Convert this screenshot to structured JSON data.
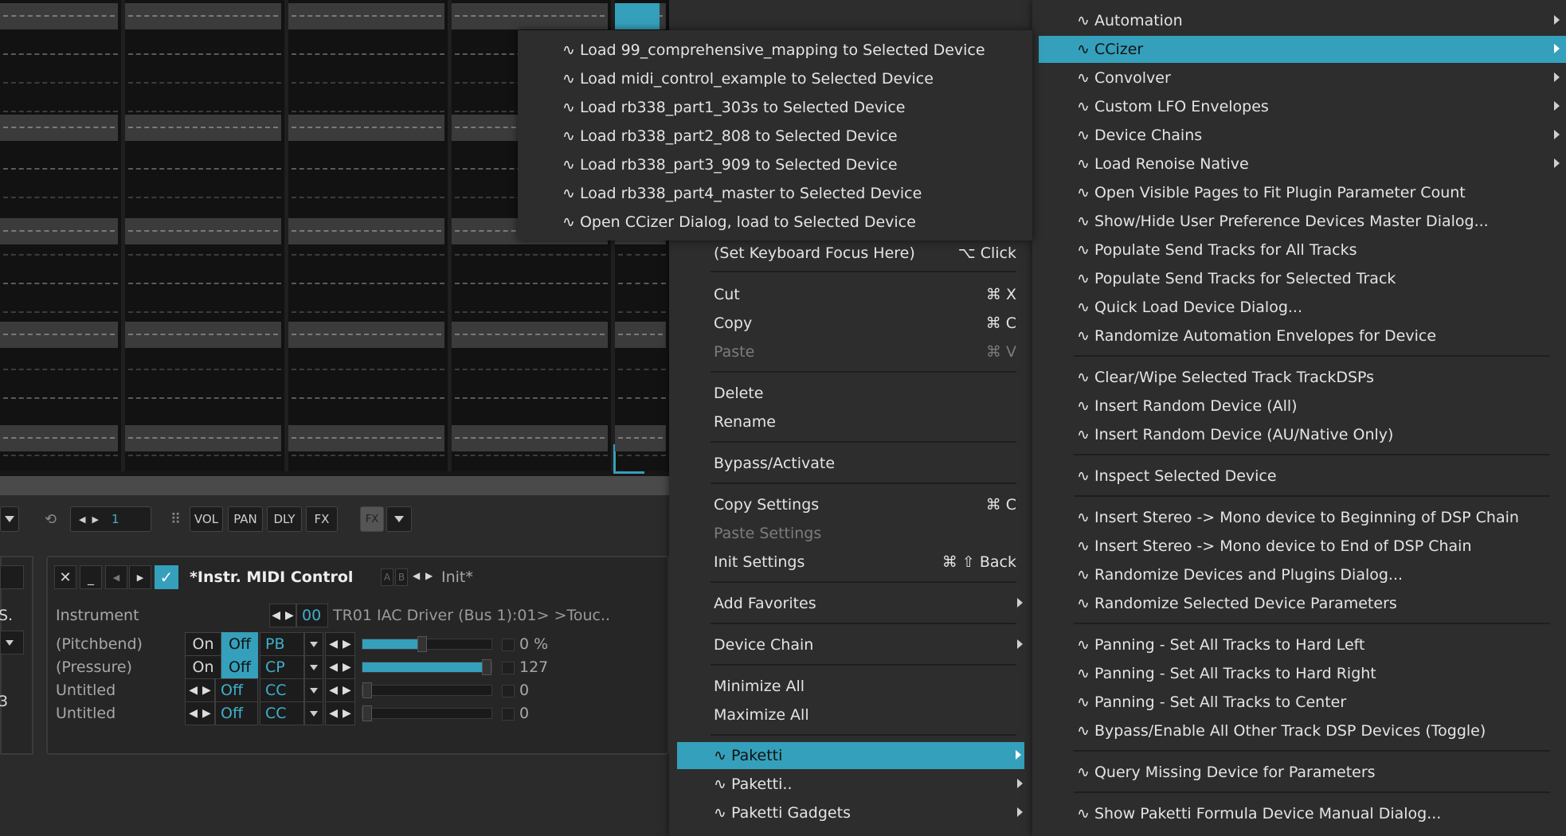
{
  "toolbar": {
    "lines_value": "1",
    "buttons": [
      "VOL",
      "PAN",
      "DLY",
      "FX"
    ],
    "fx_label": "FX"
  },
  "device": {
    "title": "*Instr. MIDI Control",
    "ab_a": "A",
    "ab_b": "B",
    "preset": "Init*",
    "left_edge_text_1": "S.",
    "left_edge_text_2": "3",
    "rows": [
      {
        "label": "Instrument",
        "num": "00",
        "value": "TR01 IAC Driver (Bus 1):01> >Touc.."
      },
      {
        "label": "(Pitchbend)",
        "on": "On",
        "off": "Off",
        "type": "PB",
        "level": 0.5,
        "value": "0 %"
      },
      {
        "label": "(Pressure)",
        "on": "On",
        "off": "Off",
        "type": "CP",
        "level": 1.0,
        "value": "127"
      },
      {
        "label": "Untitled",
        "num": "Off",
        "type": "CC",
        "level": 0.0,
        "value": "0"
      },
      {
        "label": "Untitled",
        "num": "Off",
        "type": "CC",
        "level": 0.0,
        "value": "0"
      }
    ]
  },
  "submenu_ccizer": [
    "∿ Load 99_comprehensive_mapping to Selected Device",
    "∿ Load midi_control_example to Selected Device",
    "∿ Load rb338_part1_303s to Selected Device",
    "∿ Load rb338_part2_808 to Selected Device",
    "∿ Load rb338_part3_909 to Selected Device",
    "∿ Load rb338_part4_master to Selected Device",
    "∿ Open CCizer Dialog, load to Selected Device"
  ],
  "context_menu": {
    "keyboard_focus": {
      "label": "(Set Keyboard Focus Here)",
      "shortcut": "⌥ Click"
    },
    "cut": {
      "label": "Cut",
      "shortcut": "⌘ X"
    },
    "copy": {
      "label": "Copy",
      "shortcut": "⌘ C"
    },
    "paste": {
      "label": "Paste",
      "shortcut": "⌘ V"
    },
    "delete": "Delete",
    "rename": "Rename",
    "bypass": "Bypass/Activate",
    "copy_settings": {
      "label": "Copy Settings",
      "shortcut": "⌘ C"
    },
    "paste_settings": "Paste Settings",
    "init_settings": {
      "label": "Init Settings",
      "shortcut": "⌘ ⇧ Back"
    },
    "add_favorites": "Add Favorites",
    "device_chain": "Device Chain",
    "minimize_all": "Minimize All",
    "maximize_all": "Maximize All",
    "paketti": "∿ Paketti",
    "paketti2": "∿ Paketti..",
    "paketti_gadgets": "∿ Paketti Gadgets"
  },
  "paketti_menu": {
    "automation": "∿ Automation",
    "ccizer": "∿ CCizer",
    "convolver": "∿ Convolver",
    "custom_lfo": "∿ Custom LFO Envelopes",
    "device_chains": "∿ Device Chains",
    "load_renoise_native": "∿ Load Renoise Native",
    "open_visible_pages": "∿ Open Visible Pages to Fit Plugin Parameter Count",
    "show_hide_user_pref": "∿ Show/Hide User Preference Devices Master Dialog...",
    "populate_all": "∿ Populate Send Tracks for All Tracks",
    "populate_selected": "∿ Populate Send Tracks for Selected Track",
    "quick_load": "∿ Quick Load Device Dialog...",
    "randomize_automation": "∿ Randomize Automation Envelopes for Device",
    "clear_wipe": "∿ Clear/Wipe Selected Track TrackDSPs",
    "insert_random_all": "∿ Insert Random Device (All)",
    "insert_random_au": "∿ Insert Random Device (AU/Native Only)",
    "inspect": "∿ Inspect Selected Device",
    "stereo_mono_begin": "∿ Insert Stereo -> Mono device to Beginning of DSP Chain",
    "stereo_mono_end": "∿ Insert Stereo -> Mono device to End of DSP Chain",
    "randomize_devices": "∿ Randomize Devices and Plugins Dialog...",
    "randomize_params": "∿ Randomize Selected Device Parameters",
    "pan_left": "∿ Panning - Set All Tracks to Hard Left",
    "pan_right": "∿ Panning - Set All Tracks to Hard Right",
    "pan_center": "∿ Panning - Set All Tracks to Center",
    "bypass_enable": "∿ Bypass/Enable All Other Track DSP Devices (Toggle)",
    "query_missing": "∿ Query Missing Device for Parameters",
    "show_formula": "∿ Show Paketti Formula Device Manual Dialog..."
  },
  "colors": {
    "accent": "#35a0bb",
    "menu_bg": "#2d2d2d",
    "pattern_bg": "#121212"
  }
}
